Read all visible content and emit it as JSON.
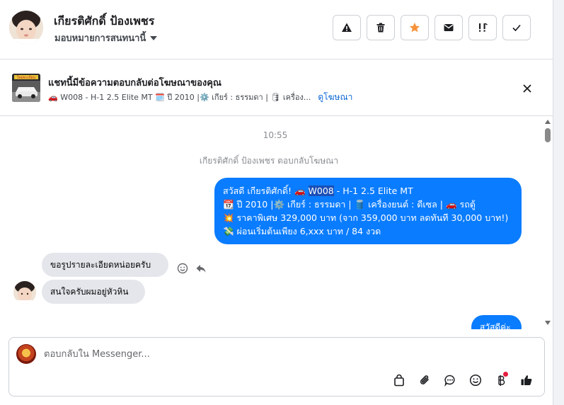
{
  "header": {
    "contact_name": "เกียรติศักดิ์ ป้องเพชร",
    "assign_label": "มอบหมายการสนทนานี้",
    "actions": [
      {
        "icon": "warning-icon"
      },
      {
        "icon": "trash-icon"
      },
      {
        "icon": "star-icon",
        "color": "#f7923b"
      },
      {
        "icon": "mail-icon"
      },
      {
        "icon": "follow-up-icon"
      },
      {
        "icon": "check-icon"
      }
    ]
  },
  "ad": {
    "thumb_text": "ใหม่ทะเบียน",
    "title": "แชทนี้มีข้อความตอบกลับต่อโฆษณาของคุณ",
    "summary": "🚗 W008 - H-1 2.5 Elite MT 🗓️ ปี 2010 |⚙️ เกียร์ : ธรรมดา | 🛢 เครื่อง...",
    "link": "ดูโฆษณา"
  },
  "chat": {
    "time": "10:55",
    "notice": "เกียรติศักดิ์ ป้องเพชร ตอบกลับโฆษณา",
    "outgoing": {
      "greeting": "สวัสดี เกียรติศักดิ์! 🚗 ",
      "highlight": "W008",
      "rest": " - H-1 2.5 Elite MT",
      "line2": "📆 ปี 2010 |⚙️ เกียร์ : ธรรมดา | 🛢️ เครื่องยนต์ : ดีเซล | 🚗 รถตู้",
      "line3": "💥 ราคาพิเศษ 329,000 บาท (จาก 359,000 บาท ลดทันที 30,000 บาท!)",
      "line4": "💸 ผ่อนเริ่มต้นเพียง 6,xxx บาท / 84 งวด"
    },
    "incoming": [
      "ขอรูปรายละเอียดหน่อยครับ",
      "สนใจครับผมอยู่หัวหิน"
    ],
    "outgoing2": "สวัสดีค่ะ"
  },
  "composer": {
    "placeholder": "ตอบกลับใน Messenger...",
    "tools": [
      "shopping-bag-icon",
      "paperclip-icon",
      "saved-reply-icon",
      "emoji-icon",
      "payment-icon",
      "like-icon"
    ],
    "notification_color": "#e41e3f"
  },
  "colors": {
    "messenger_blue": "#0a7cff",
    "incoming_bubble": "#e4e6eb",
    "link": "#0a66d6"
  }
}
